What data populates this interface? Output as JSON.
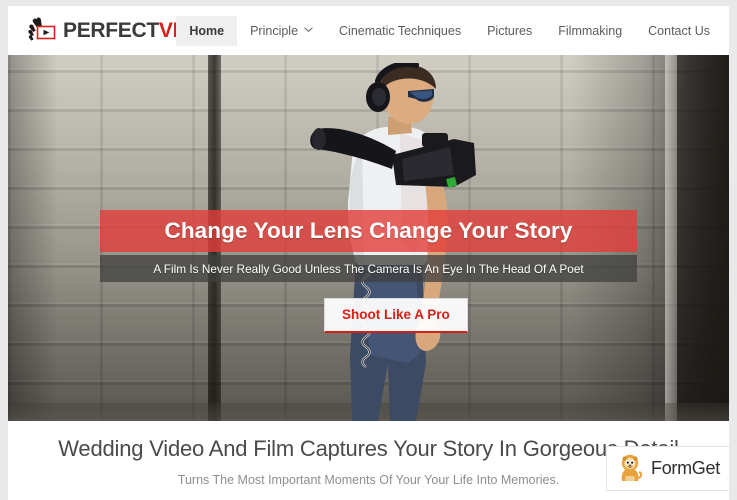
{
  "site": {
    "brand": {
      "icon": "ok-hand-play-logo-icon",
      "name_part1": "PERFECT",
      "name_part2": "VIDEO"
    },
    "nav": {
      "items": [
        {
          "label": "Home",
          "active": true,
          "has_dropdown": false
        },
        {
          "label": "Principle",
          "active": false,
          "has_dropdown": true
        },
        {
          "label": "Cinematic Techniques",
          "active": false,
          "has_dropdown": false
        },
        {
          "label": "Pictures",
          "active": false,
          "has_dropdown": false
        },
        {
          "label": "Filmmaking",
          "active": false,
          "has_dropdown": false
        },
        {
          "label": "Contact Us",
          "active": false,
          "has_dropdown": false
        }
      ]
    }
  },
  "hero": {
    "title": "Change Your Lens Change Your Story",
    "subtitle": "A Film Is Never Really Good Unless The Camera Is An Eye In The Head Of A Poet",
    "cta_label": "Shoot Like A Pro",
    "image_description": "videographer-with-shoulder-camera-against-concrete-block-wall"
  },
  "intro": {
    "title": "Wedding Video And Film Captures Your Story In Gorgeous Detail",
    "subtitle": "Turns The Most Important Moments Of Your Your Life Into Memories."
  },
  "watermark": {
    "label": "FormGet",
    "mascot": "lion-mascot-icon"
  },
  "colors": {
    "brand_red": "#d8201b",
    "hero_band_red": "#e23d38",
    "hero_band_gray": "#40403e",
    "nav_text": "#5c5c5c",
    "nav_active_bg": "#efefef",
    "intro_title": "#4a4a4a",
    "intro_sub": "#8e8e8e",
    "page_bg": "#e9e9e9"
  }
}
